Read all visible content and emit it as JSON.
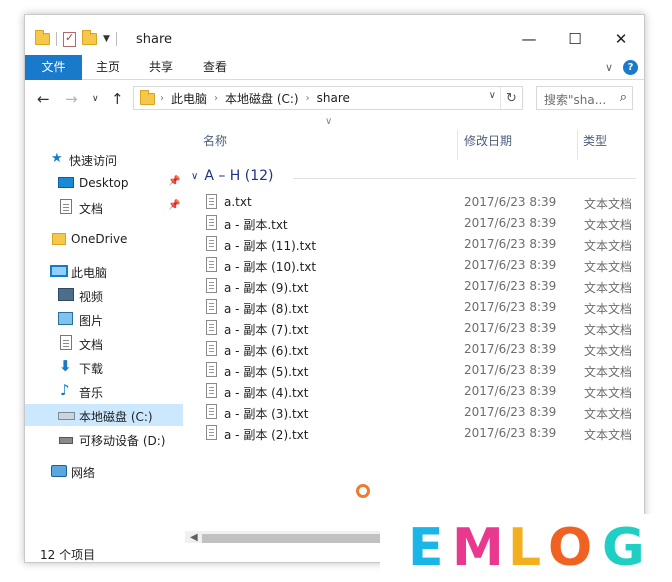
{
  "window": {
    "title": "share",
    "controls": {
      "minimize": "—",
      "maximize": "☐",
      "close": "✕"
    }
  },
  "ribbon": {
    "tabs": [
      "文件",
      "主页",
      "共享",
      "查看"
    ],
    "help": "?"
  },
  "address": {
    "segments": [
      "此电脑",
      "本地磁盘 (C:)",
      "share"
    ],
    "search_placeholder": "搜索\"sha..."
  },
  "navigation": {
    "quick_access": "快速访问",
    "pinned": [
      "Desktop",
      "文档"
    ],
    "onedrive": "OneDrive",
    "this_pc": "此电脑",
    "pc_items": [
      "视频",
      "图片",
      "文档",
      "下载",
      "音乐",
      "本地磁盘 (C:)",
      "可移动设备 (D:)"
    ],
    "network": "网络",
    "selected": "本地磁盘 (C:)"
  },
  "columns": {
    "name": "名称",
    "modified": "修改日期",
    "type": "类型"
  },
  "group": {
    "label": "A – H (12)"
  },
  "files": [
    {
      "name": "a.txt",
      "date": "2017/6/23 8:39",
      "type": "文本文档"
    },
    {
      "name": "a - 副本.txt",
      "date": "2017/6/23 8:39",
      "type": "文本文档"
    },
    {
      "name": "a - 副本 (11).txt",
      "date": "2017/6/23 8:39",
      "type": "文本文档"
    },
    {
      "name": "a - 副本 (10).txt",
      "date": "2017/6/23 8:39",
      "type": "文本文档"
    },
    {
      "name": "a - 副本 (9).txt",
      "date": "2017/6/23 8:39",
      "type": "文本文档"
    },
    {
      "name": "a - 副本 (8).txt",
      "date": "2017/6/23 8:39",
      "type": "文本文档"
    },
    {
      "name": "a - 副本 (7).txt",
      "date": "2017/6/23 8:39",
      "type": "文本文档"
    },
    {
      "name": "a - 副本 (6).txt",
      "date": "2017/6/23 8:39",
      "type": "文本文档"
    },
    {
      "name": "a - 副本 (5).txt",
      "date": "2017/6/23 8:39",
      "type": "文本文档"
    },
    {
      "name": "a - 副本 (4).txt",
      "date": "2017/6/23 8:39",
      "type": "文本文档"
    },
    {
      "name": "a - 副本 (3).txt",
      "date": "2017/6/23 8:39",
      "type": "文本文档"
    },
    {
      "name": "a - 副本 (2).txt",
      "date": "2017/6/23 8:39",
      "type": "文本文档"
    }
  ],
  "status": {
    "text": "12 个项目"
  },
  "watermark": {
    "letters": [
      "E",
      "M",
      "L",
      "O",
      "G"
    ],
    "colors": [
      "#1bb6e8",
      "#e8398f",
      "#f2b01e",
      "#ef6222",
      "#1fcfc3"
    ]
  }
}
